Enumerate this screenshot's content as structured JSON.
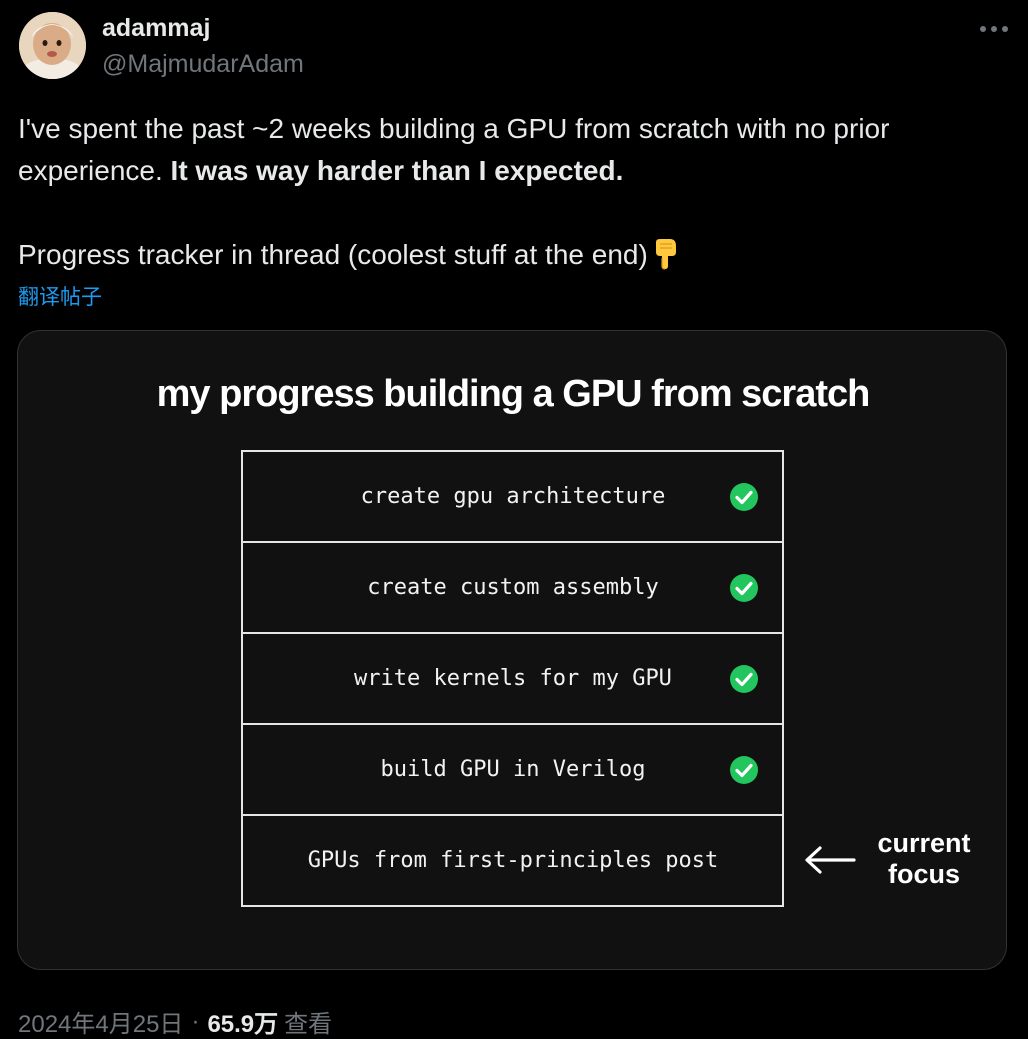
{
  "author": {
    "display_name": "adammaj",
    "handle": "@MajmudarAdam",
    "avatar_icon": "avatar-baby-photo"
  },
  "header": {
    "more_icon": "more-horizontal-icon"
  },
  "tweet": {
    "line1_regular": "I've spent the past ~2 weeks building a GPU from scratch with no prior experience. ",
    "line1_bold": "It was way harder than I expected.",
    "line2": "Progress tracker in thread (coolest stuff at the end)",
    "line2_emoji": "pointing-down-icon",
    "translate_label": "翻译帖子"
  },
  "media": {
    "title": "my progress building a GPU from scratch",
    "steps": [
      {
        "label": "create gpu architecture",
        "done": true
      },
      {
        "label": "create custom assembly",
        "done": true
      },
      {
        "label": "write kernels for my GPU",
        "done": true
      },
      {
        "label": "build GPU in Verilog",
        "done": true
      },
      {
        "label": "GPUs from first-principles post",
        "done": false
      }
    ],
    "focus_label_line1": "current",
    "focus_label_line2": "focus",
    "check_color": "#22c55e"
  },
  "footer": {
    "date": "2024年4月25日",
    "separator": "·",
    "views_count": "65.9万",
    "views_label": "查看"
  },
  "colors": {
    "background": "#000000",
    "primary_text": "#e7e9ea",
    "secondary_text": "#71767b",
    "link": "#1d9bf0",
    "card_background": "#111111"
  }
}
